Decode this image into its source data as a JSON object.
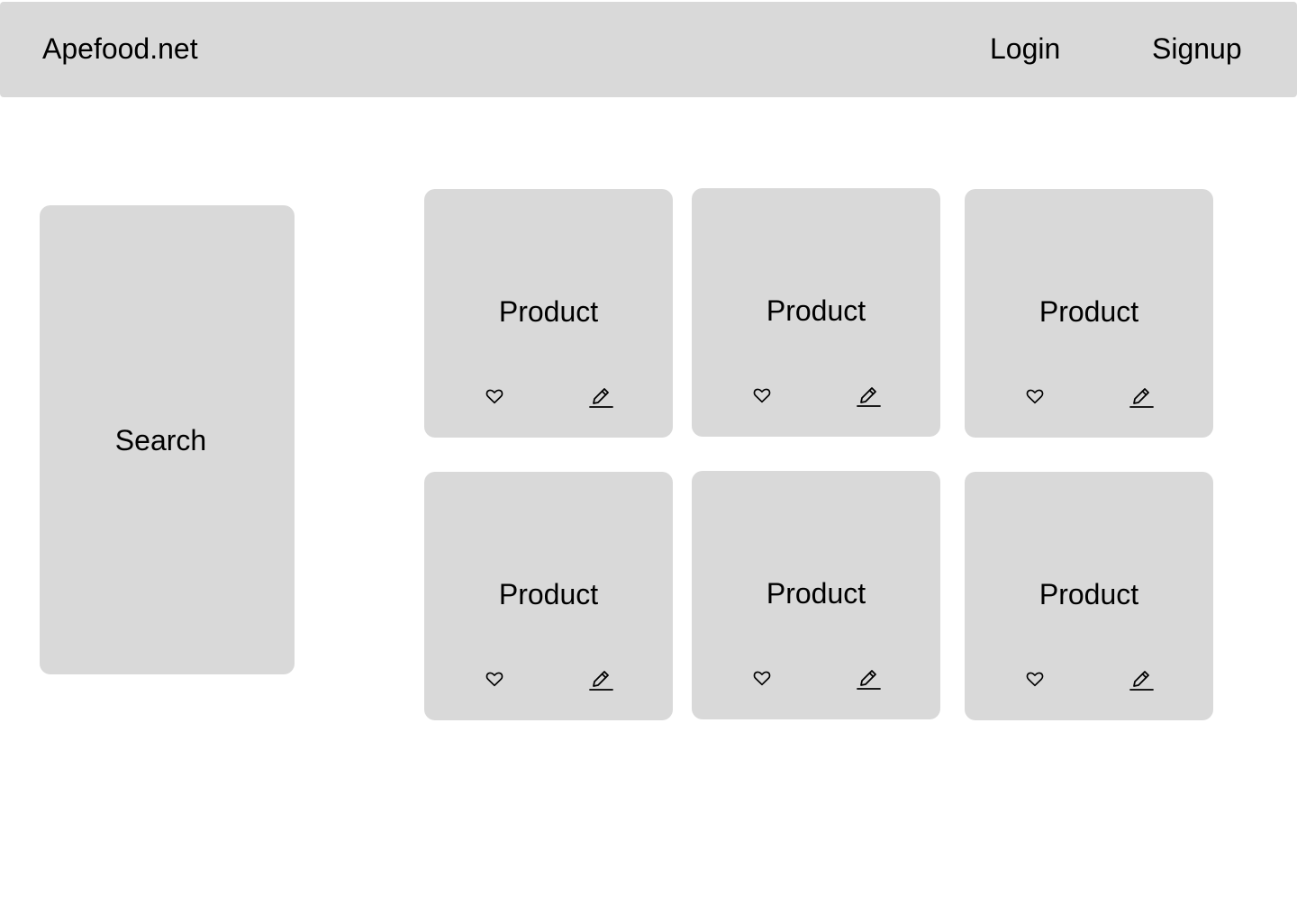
{
  "header": {
    "brand": "Apefood.net",
    "login_label": "Login",
    "signup_label": "Signup"
  },
  "sidebar": {
    "search_label": "Search"
  },
  "products": [
    {
      "title": "Product",
      "icons": [
        "heart-icon",
        "edit-pencil-icon"
      ]
    },
    {
      "title": "Product",
      "icons": [
        "heart-icon",
        "edit-pencil-icon"
      ]
    },
    {
      "title": "Product",
      "icons": [
        "heart-icon",
        "edit-pencil-icon"
      ]
    },
    {
      "title": "Product",
      "icons": [
        "heart-icon",
        "edit-pencil-icon"
      ]
    },
    {
      "title": "Product",
      "icons": [
        "heart-icon",
        "edit-pencil-icon"
      ]
    },
    {
      "title": "Product",
      "icons": [
        "heart-icon",
        "edit-pencil-icon"
      ]
    }
  ],
  "colors": {
    "panel": "#d9d9d9",
    "background": "#ffffff",
    "text": "#000000"
  }
}
